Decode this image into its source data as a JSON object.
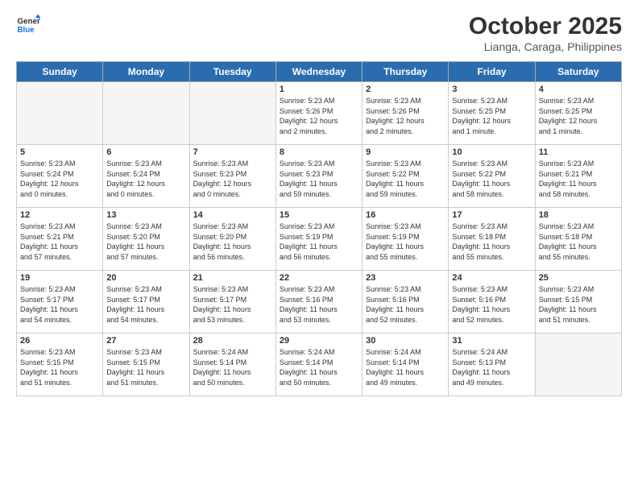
{
  "header": {
    "logo_line1": "General",
    "logo_line2": "Blue",
    "month": "October 2025",
    "location": "Lianga, Caraga, Philippines"
  },
  "weekdays": [
    "Sunday",
    "Monday",
    "Tuesday",
    "Wednesday",
    "Thursday",
    "Friday",
    "Saturday"
  ],
  "weeks": [
    [
      {
        "day": "",
        "info": ""
      },
      {
        "day": "",
        "info": ""
      },
      {
        "day": "",
        "info": ""
      },
      {
        "day": "1",
        "info": "Sunrise: 5:23 AM\nSunset: 5:26 PM\nDaylight: 12 hours\nand 2 minutes."
      },
      {
        "day": "2",
        "info": "Sunrise: 5:23 AM\nSunset: 5:26 PM\nDaylight: 12 hours\nand 2 minutes."
      },
      {
        "day": "3",
        "info": "Sunrise: 5:23 AM\nSunset: 5:25 PM\nDaylight: 12 hours\nand 1 minute."
      },
      {
        "day": "4",
        "info": "Sunrise: 5:23 AM\nSunset: 5:25 PM\nDaylight: 12 hours\nand 1 minute."
      }
    ],
    [
      {
        "day": "5",
        "info": "Sunrise: 5:23 AM\nSunset: 5:24 PM\nDaylight: 12 hours\nand 0 minutes."
      },
      {
        "day": "6",
        "info": "Sunrise: 5:23 AM\nSunset: 5:24 PM\nDaylight: 12 hours\nand 0 minutes."
      },
      {
        "day": "7",
        "info": "Sunrise: 5:23 AM\nSunset: 5:23 PM\nDaylight: 12 hours\nand 0 minutes."
      },
      {
        "day": "8",
        "info": "Sunrise: 5:23 AM\nSunset: 5:23 PM\nDaylight: 11 hours\nand 59 minutes."
      },
      {
        "day": "9",
        "info": "Sunrise: 5:23 AM\nSunset: 5:22 PM\nDaylight: 11 hours\nand 59 minutes."
      },
      {
        "day": "10",
        "info": "Sunrise: 5:23 AM\nSunset: 5:22 PM\nDaylight: 11 hours\nand 58 minutes."
      },
      {
        "day": "11",
        "info": "Sunrise: 5:23 AM\nSunset: 5:21 PM\nDaylight: 11 hours\nand 58 minutes."
      }
    ],
    [
      {
        "day": "12",
        "info": "Sunrise: 5:23 AM\nSunset: 5:21 PM\nDaylight: 11 hours\nand 57 minutes."
      },
      {
        "day": "13",
        "info": "Sunrise: 5:23 AM\nSunset: 5:20 PM\nDaylight: 11 hours\nand 57 minutes."
      },
      {
        "day": "14",
        "info": "Sunrise: 5:23 AM\nSunset: 5:20 PM\nDaylight: 11 hours\nand 56 minutes."
      },
      {
        "day": "15",
        "info": "Sunrise: 5:23 AM\nSunset: 5:19 PM\nDaylight: 11 hours\nand 56 minutes."
      },
      {
        "day": "16",
        "info": "Sunrise: 5:23 AM\nSunset: 5:19 PM\nDaylight: 11 hours\nand 55 minutes."
      },
      {
        "day": "17",
        "info": "Sunrise: 5:23 AM\nSunset: 5:18 PM\nDaylight: 11 hours\nand 55 minutes."
      },
      {
        "day": "18",
        "info": "Sunrise: 5:23 AM\nSunset: 5:18 PM\nDaylight: 11 hours\nand 55 minutes."
      }
    ],
    [
      {
        "day": "19",
        "info": "Sunrise: 5:23 AM\nSunset: 5:17 PM\nDaylight: 11 hours\nand 54 minutes."
      },
      {
        "day": "20",
        "info": "Sunrise: 5:23 AM\nSunset: 5:17 PM\nDaylight: 11 hours\nand 54 minutes."
      },
      {
        "day": "21",
        "info": "Sunrise: 5:23 AM\nSunset: 5:17 PM\nDaylight: 11 hours\nand 53 minutes."
      },
      {
        "day": "22",
        "info": "Sunrise: 5:23 AM\nSunset: 5:16 PM\nDaylight: 11 hours\nand 53 minutes."
      },
      {
        "day": "23",
        "info": "Sunrise: 5:23 AM\nSunset: 5:16 PM\nDaylight: 11 hours\nand 52 minutes."
      },
      {
        "day": "24",
        "info": "Sunrise: 5:23 AM\nSunset: 5:16 PM\nDaylight: 11 hours\nand 52 minutes."
      },
      {
        "day": "25",
        "info": "Sunrise: 5:23 AM\nSunset: 5:15 PM\nDaylight: 11 hours\nand 51 minutes."
      }
    ],
    [
      {
        "day": "26",
        "info": "Sunrise: 5:23 AM\nSunset: 5:15 PM\nDaylight: 11 hours\nand 51 minutes."
      },
      {
        "day": "27",
        "info": "Sunrise: 5:23 AM\nSunset: 5:15 PM\nDaylight: 11 hours\nand 51 minutes."
      },
      {
        "day": "28",
        "info": "Sunrise: 5:24 AM\nSunset: 5:14 PM\nDaylight: 11 hours\nand 50 minutes."
      },
      {
        "day": "29",
        "info": "Sunrise: 5:24 AM\nSunset: 5:14 PM\nDaylight: 11 hours\nand 50 minutes."
      },
      {
        "day": "30",
        "info": "Sunrise: 5:24 AM\nSunset: 5:14 PM\nDaylight: 11 hours\nand 49 minutes."
      },
      {
        "day": "31",
        "info": "Sunrise: 5:24 AM\nSunset: 5:13 PM\nDaylight: 11 hours\nand 49 minutes."
      },
      {
        "day": "",
        "info": ""
      }
    ]
  ]
}
